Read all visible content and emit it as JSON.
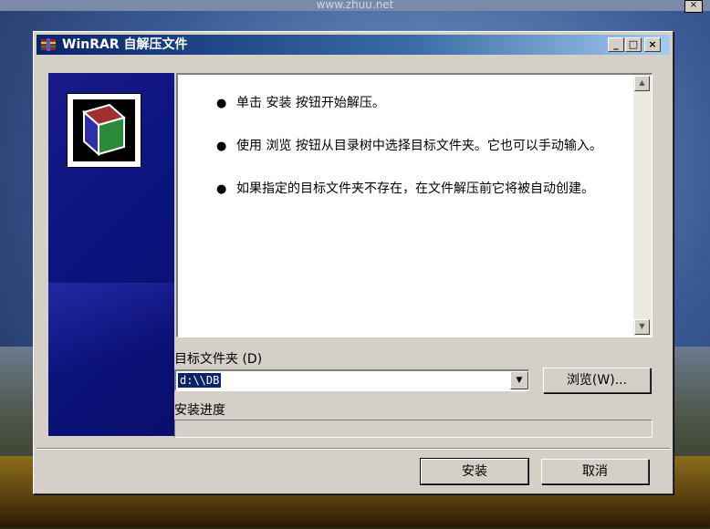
{
  "outer_window": {
    "title": "www.zhuu.net",
    "close_glyph": "×"
  },
  "dialog": {
    "title": "WinRAR 自解压文件",
    "icon": "winrar-icon",
    "buttons": {
      "minimize": "_",
      "maximize": "□",
      "close": "×"
    }
  },
  "banner": {
    "logo": "winrar-book-icon"
  },
  "info": {
    "items": [
      {
        "text": "单击 安装 按钮开始解压。"
      },
      {
        "text": "使用 浏览 按钮从目录树中选择目标文件夹。它也可以手动输入。"
      },
      {
        "text": "如果指定的目标文件夹不存在，在文件解压前它将被自动创建。"
      }
    ]
  },
  "target_folder": {
    "label": "目标文件夹 (D)",
    "value": "d:\\\\DB",
    "browse_label": "浏览(W)..."
  },
  "progress": {
    "label": "安装进度",
    "fraction": 0
  },
  "actions": {
    "install_label": "安装",
    "cancel_label": "取消"
  }
}
